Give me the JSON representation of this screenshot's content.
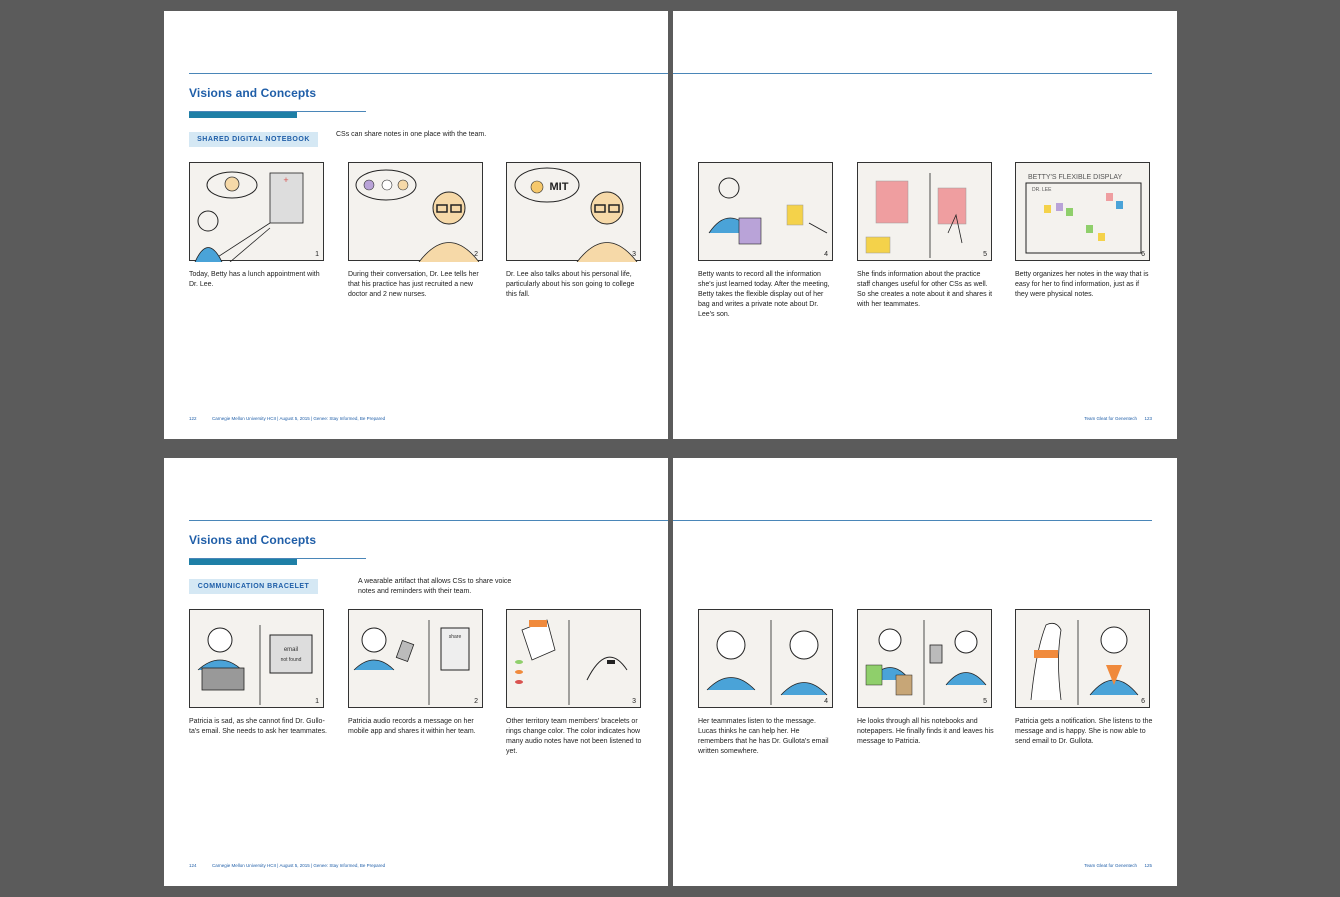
{
  "spreads": [
    {
      "left_page": {
        "section_title": "Visions and Concepts",
        "tag": "SHARED DIGITAL NOTEBOOK",
        "tag_description": "CSs can share notes in one place with the team.",
        "panels": [
          {
            "number": "1",
            "caption": "Today, Betty has a lunch appointment with Dr. Lee."
          },
          {
            "number": "2",
            "caption": "During their conversation, Dr. Lee tells her that his practice has just recruited a new doctor and 2 new nurses."
          },
          {
            "number": "3",
            "caption": "Dr. Lee also talks about his personal life, particularly about his son going to college this fall.",
            "sketch_text": "MIT"
          }
        ],
        "footer_page": "122",
        "footer_text": "Carnegie Mellon University HCII  |  August 5, 2015  |  Genee: Stay Informed, Be Prepared"
      },
      "right_page": {
        "panels": [
          {
            "number": "4",
            "caption": "Betty wants to record all the information she's just learned today. After the meeting, Betty takes the flexible display out of her bag and writes a private note about Dr. Lee's son."
          },
          {
            "number": "5",
            "caption": "She finds information about the practice staff changes useful for other CSs as well. So she creates a note about it and shares it with her teammates."
          },
          {
            "number": "6",
            "caption": "Betty organizes her notes in the way that is easy for her to find information, just as if they were physical notes.",
            "sketch_text": "BETTY'S FLEXIBLE DISPLAY",
            "sketch_text_2": "DR. LEE"
          }
        ],
        "footer_text": "Team Gleat for Genentech",
        "footer_page": "123"
      }
    },
    {
      "left_page": {
        "section_title": "Visions and Concepts",
        "tag": "COMMUNICATION BRACELET",
        "tag_description": "A wearable artifact that allows CSs to share voice notes and reminders with their team.",
        "panels": [
          {
            "number": "1",
            "caption": "Patricia is sad, as she cannot find Dr. Gullo-ta's email. She needs to ask her teammates.",
            "sketch_text": "email",
            "sketch_text_2": "not found"
          },
          {
            "number": "2",
            "caption": "Patricia audio records a message on her mobile app and shares it within her team.",
            "sketch_text": "share"
          },
          {
            "number": "3",
            "caption": "Other territory team members' bracelets or rings change color. The color indicates how many audio notes have not been listened to yet."
          }
        ],
        "footer_page": "124",
        "footer_text": "Carnegie Mellon University HCII  |  August 5, 2015  |  Genee: Stay Informed, Be Prepared"
      },
      "right_page": {
        "panels": [
          {
            "number": "4",
            "caption": "Her teammates listen to the message. Lucas thinks he can help her. He remembers that he has Dr. Gullota's email written somewhere."
          },
          {
            "number": "5",
            "caption": "He looks through all his notebooks and notepapers. He finally finds it and leaves his message to Patricia."
          },
          {
            "number": "6",
            "caption": "Patricia gets a notification. She listens to the message and is happy. She is now able to send email to Dr. Gullota."
          }
        ],
        "footer_text": "Team Gleat for Genentech",
        "footer_page": "125"
      }
    }
  ],
  "colors": {
    "background": "#5b5b5b",
    "title_blue": "#1f5ea8",
    "rule_blue": "#4a86b8",
    "accent_bar": "#1e7fa6",
    "tag_bg": "#d5e8f4",
    "sketch_blue": "#4aa3d8",
    "sketch_orange": "#f08a3c",
    "sketch_red": "#d9534f"
  }
}
